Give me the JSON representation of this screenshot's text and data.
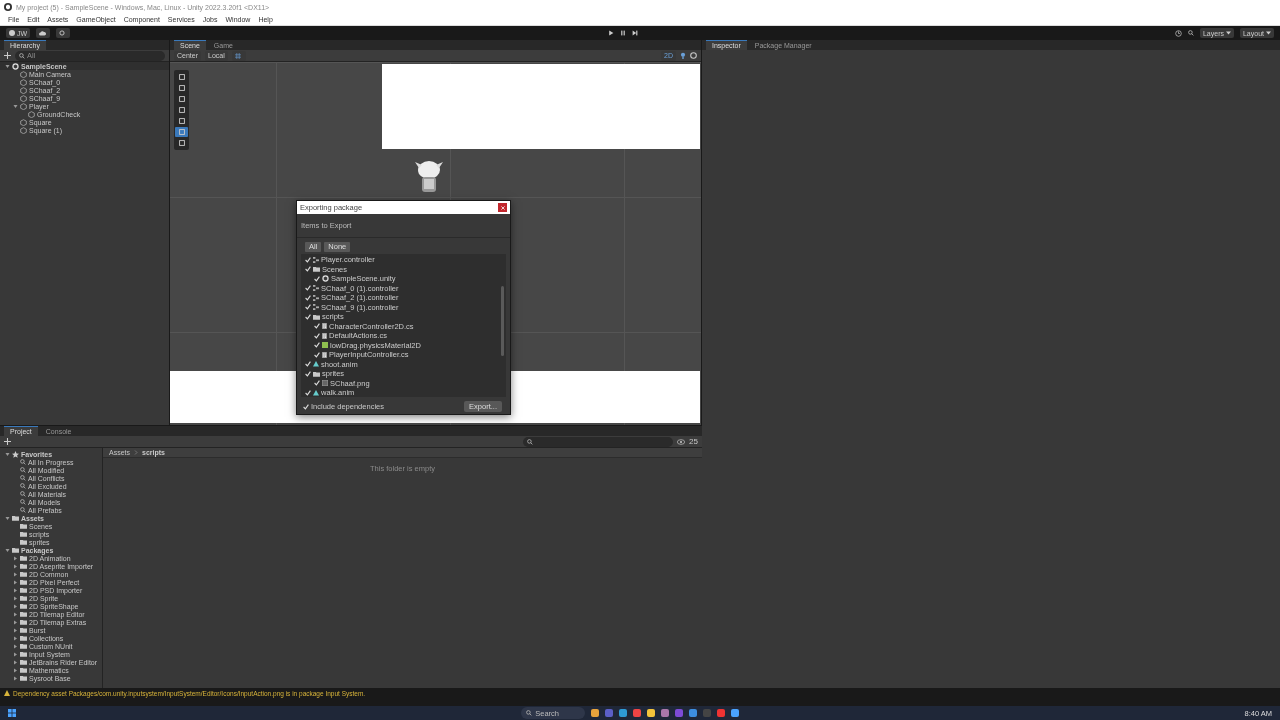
{
  "window": {
    "title": "My project (5) - SampleScene - Windows, Mac, Linux - Unity 2022.3.20f1 <DX11>"
  },
  "menu": [
    "File",
    "Edit",
    "Assets",
    "GameObject",
    "Component",
    "Services",
    "Jobs",
    "Window",
    "Help"
  ],
  "toolbar": {
    "account": "JW",
    "right": [
      "Layers",
      "Layout"
    ]
  },
  "hierarchy": {
    "tab": "Hierarchy",
    "search_placeholder": "All",
    "items": [
      {
        "label": "SampleScene",
        "kind": "scene",
        "expanded": true,
        "children": [
          {
            "label": "Main Camera",
            "kind": "object"
          },
          {
            "label": "SChaaf_0",
            "kind": "object"
          },
          {
            "label": "SChaaf_2",
            "kind": "object"
          },
          {
            "label": "SChaaf_9",
            "kind": "object"
          },
          {
            "label": "Player",
            "kind": "object",
            "expanded": true,
            "children": [
              {
                "label": "GroundCheck",
                "kind": "object"
              }
            ]
          },
          {
            "label": "Square",
            "kind": "object"
          },
          {
            "label": "Square (1)",
            "kind": "object"
          }
        ]
      }
    ]
  },
  "scene": {
    "tabs": [
      {
        "label": "Scene",
        "selected": true
      },
      {
        "label": "Game",
        "selected": false
      }
    ],
    "pivot": "Center",
    "space": "Local",
    "mode": "2D"
  },
  "inspector": {
    "tabs": [
      {
        "label": "Inspector",
        "selected": true
      },
      {
        "label": "Package Manager",
        "selected": false
      }
    ]
  },
  "export_dialog": {
    "title": "Exporting package",
    "heading": "Items to Export",
    "buttons": [
      "All",
      "None"
    ],
    "items": [
      {
        "label": "Player.controller",
        "kind": "controller",
        "checked": true
      },
      {
        "label": "Scenes",
        "kind": "folder",
        "checked": true,
        "children": [
          {
            "label": "SampleScene.unity",
            "kind": "scene",
            "checked": true
          }
        ]
      },
      {
        "label": "SChaaf_0 (1).controller",
        "kind": "controller",
        "checked": true
      },
      {
        "label": "SChaaf_2 (1).controller",
        "kind": "controller",
        "checked": true
      },
      {
        "label": "SChaaf_9 (1).controller",
        "kind": "controller",
        "checked": true
      },
      {
        "label": "scripts",
        "kind": "folder",
        "checked": true,
        "children": [
          {
            "label": "CharacterController2D.cs",
            "kind": "script",
            "checked": true
          },
          {
            "label": "DefaultActions.cs",
            "kind": "script",
            "checked": true
          },
          {
            "label": "lowDrag.physicsMaterial2D",
            "kind": "material",
            "checked": true
          },
          {
            "label": "PlayerInputController.cs",
            "kind": "script",
            "checked": true
          }
        ]
      },
      {
        "label": "shoot.anim",
        "kind": "anim",
        "checked": true
      },
      {
        "label": "sprites",
        "kind": "folder",
        "checked": true,
        "children": [
          {
            "label": "SChaaf.png",
            "kind": "image",
            "checked": true
          }
        ]
      },
      {
        "label": "walk.anim",
        "kind": "anim",
        "checked": true
      }
    ],
    "include_dependencies": {
      "label": "Include dependencies",
      "checked": true
    },
    "export_button": "Export..."
  },
  "project": {
    "tabs": [
      {
        "label": "Project",
        "selected": true
      },
      {
        "label": "Console",
        "selected": false
      }
    ],
    "tree": [
      {
        "label": "Favorites",
        "kind": "favorites",
        "expanded": true,
        "children": [
          {
            "label": "All In Progress",
            "kind": "search"
          },
          {
            "label": "All Modified",
            "kind": "search"
          },
          {
            "label": "All Conflicts",
            "kind": "search"
          },
          {
            "label": "All Excluded",
            "kind": "search"
          },
          {
            "label": "All Materials",
            "kind": "search"
          },
          {
            "label": "All Models",
            "kind": "search"
          },
          {
            "label": "All Prefabs",
            "kind": "search"
          }
        ]
      },
      {
        "label": "Assets",
        "kind": "root",
        "expanded": true,
        "children": [
          {
            "label": "Scenes",
            "kind": "folder"
          },
          {
            "label": "scripts",
            "kind": "folder"
          },
          {
            "label": "sprites",
            "kind": "folder"
          }
        ]
      },
      {
        "label": "Packages",
        "kind": "root",
        "expanded": true,
        "children": [
          {
            "label": "2D Animation",
            "kind": "folder",
            "expanded": false
          },
          {
            "label": "2D Aseprite Importer",
            "kind": "folder",
            "expanded": false
          },
          {
            "label": "2D Common",
            "kind": "folder",
            "expanded": false
          },
          {
            "label": "2D Pixel Perfect",
            "kind": "folder",
            "expanded": false
          },
          {
            "label": "2D PSD Importer",
            "kind": "folder",
            "expanded": false
          },
          {
            "label": "2D Sprite",
            "kind": "folder",
            "expanded": false
          },
          {
            "label": "2D SpriteShape",
            "kind": "folder",
            "expanded": false
          },
          {
            "label": "2D Tilemap Editor",
            "kind": "folder",
            "expanded": false
          },
          {
            "label": "2D Tilemap Extras",
            "kind": "folder",
            "expanded": false
          },
          {
            "label": "Burst",
            "kind": "folder",
            "expanded": false
          },
          {
            "label": "Collections",
            "kind": "folder",
            "expanded": false
          },
          {
            "label": "Custom NUnit",
            "kind": "folder",
            "expanded": false
          },
          {
            "label": "Input System",
            "kind": "folder",
            "expanded": false
          },
          {
            "label": "JetBrains Rider Editor",
            "kind": "folder",
            "expanded": false
          },
          {
            "label": "Mathematics",
            "kind": "folder",
            "expanded": false
          },
          {
            "label": "Sysroot Base",
            "kind": "folder",
            "expanded": false
          }
        ]
      }
    ],
    "breadcrumb": [
      "Assets",
      "scripts"
    ],
    "empty_message": "This folder is empty",
    "hidden_count": "25"
  },
  "status_bar": {
    "message": "Dependency asset Packages/com.unity.inputsystem/InputSystem/Editor/Icons/InputAction.png is in package Input System."
  },
  "taskbar": {
    "search_placeholder": "Search",
    "time": "8:40 AM"
  }
}
